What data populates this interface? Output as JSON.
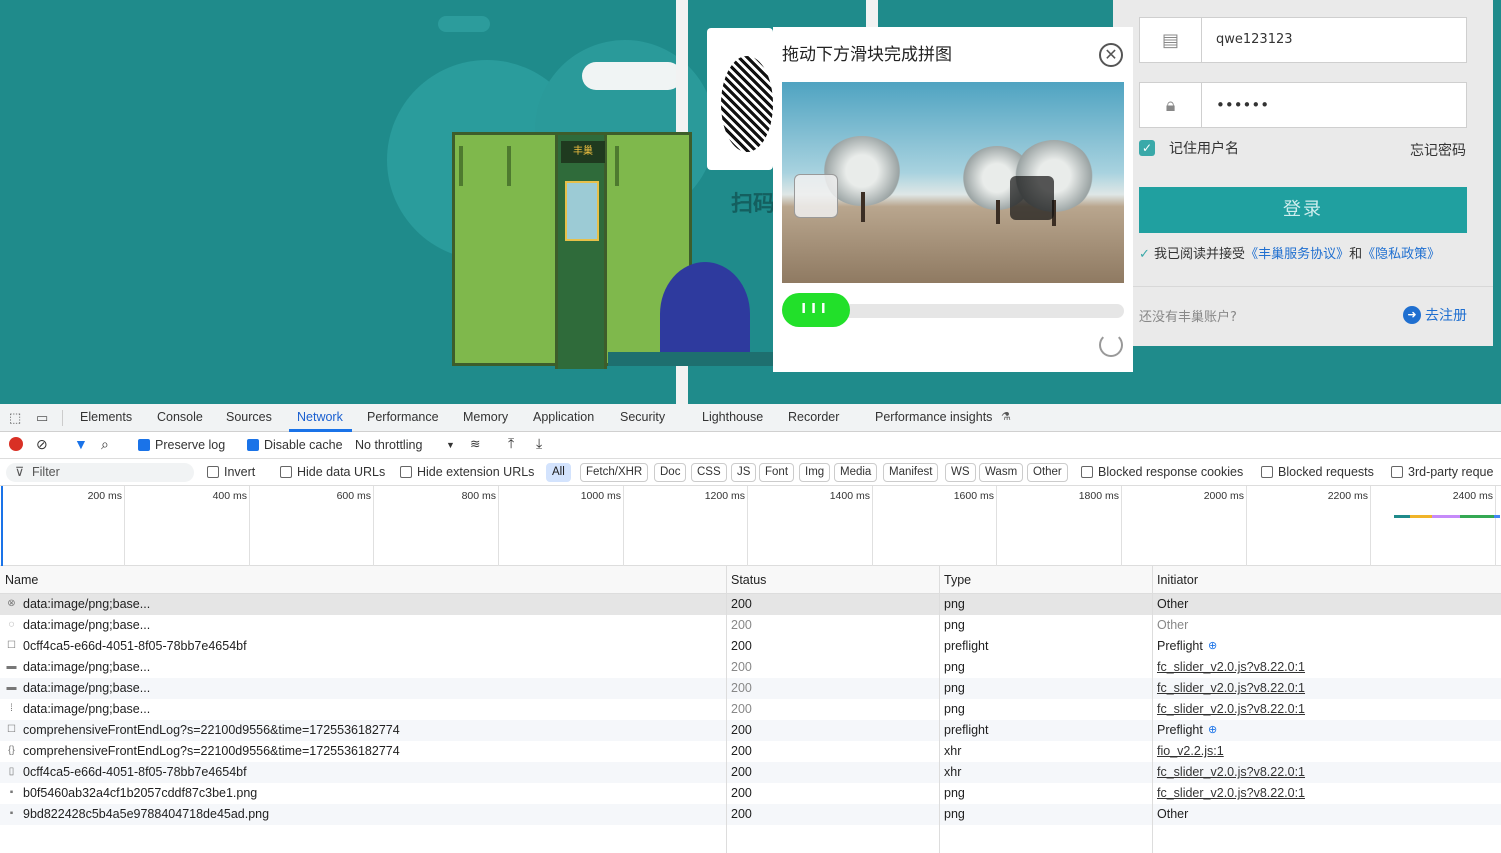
{
  "captcha": {
    "title": "拖动下方滑块完成拼图",
    "knob_label": "III",
    "slider_position_fraction": 0.0
  },
  "background_page": {
    "locker_sign": "丰巢",
    "scan_text": "扫码"
  },
  "login": {
    "username": "qwe123123",
    "password_masked": "••••••",
    "remember_label": "记住用户名",
    "forgot_label": "忘记密码",
    "login_button": "登录",
    "agree_prefix": "我已阅读并接受",
    "agree_terms": "《丰巢服务协议》",
    "agree_and": "和",
    "agree_privacy": "《隐私政策》",
    "no_account": "还没有丰巢账户?",
    "register": "去注册",
    "accent_color": "#20a0a0"
  },
  "devtools": {
    "tabs": [
      "Elements",
      "Console",
      "Sources",
      "Network",
      "Performance",
      "Memory",
      "Application",
      "Security",
      "Lighthouse",
      "Recorder",
      "Performance insights"
    ],
    "active_tab": "Network",
    "toolbar": {
      "preserve_log": "Preserve log",
      "disable_cache": "Disable cache",
      "throttling": "No throttling"
    },
    "filter": {
      "placeholder": "Filter",
      "invert": "Invert",
      "hide_data_urls": "Hide data URLs",
      "hide_extension_urls": "Hide extension URLs",
      "types": [
        "All",
        "Fetch/XHR",
        "Doc",
        "CSS",
        "JS",
        "Font",
        "Img",
        "Media",
        "Manifest",
        "WS",
        "Wasm",
        "Other"
      ],
      "blocked_cookies": "Blocked response cookies",
      "blocked_requests": "Blocked requests",
      "third_party": "3rd-party reque"
    },
    "timeline_ticks": [
      "200 ms",
      "400 ms",
      "600 ms",
      "800 ms",
      "1000 ms",
      "1200 ms",
      "1400 ms",
      "1600 ms",
      "1800 ms",
      "2000 ms",
      "2200 ms",
      "2400 ms"
    ],
    "columns": [
      "Name",
      "Status",
      "Type",
      "Initiator"
    ],
    "rows": [
      {
        "icon": "⊗",
        "name": "data:image/png;base...",
        "status": "200",
        "type": "png",
        "initiator": "Other",
        "style": "sel",
        "dim": false,
        "link": false
      },
      {
        "icon": "◌",
        "name": "data:image/png;base...",
        "status": "200",
        "type": "png",
        "initiator": "Other",
        "style": "",
        "dim": true,
        "link": false
      },
      {
        "icon": "☐",
        "name": "0cff4ca5-e66d-4051-8f05-78bb7e4654bf",
        "status": "200",
        "type": "preflight",
        "initiator": "Preflight",
        "style": "",
        "dim": false,
        "link": false
      },
      {
        "icon": "▬",
        "name": "data:image/png;base...",
        "status": "200",
        "type": "png",
        "initiator": "fc_slider_v2.0.js?v8.22.0:1",
        "style": "",
        "dim": true,
        "link": true
      },
      {
        "icon": "▬",
        "name": "data:image/png;base...",
        "status": "200",
        "type": "png",
        "initiator": "fc_slider_v2.0.js?v8.22.0:1",
        "style": "alt",
        "dim": true,
        "link": true
      },
      {
        "icon": "⁞",
        "name": "data:image/png;base...",
        "status": "200",
        "type": "png",
        "initiator": "fc_slider_v2.0.js?v8.22.0:1",
        "style": "",
        "dim": true,
        "link": true
      },
      {
        "icon": "☐",
        "name": "comprehensiveFrontEndLog?s=22100d9556&time=1725536182774",
        "status": "200",
        "type": "preflight",
        "initiator": "Preflight",
        "style": "alt",
        "dim": false,
        "link": false
      },
      {
        "icon": "{}",
        "name": "comprehensiveFrontEndLog?s=22100d9556&time=1725536182774",
        "status": "200",
        "type": "xhr",
        "initiator": "fio_v2.2.js:1",
        "style": "",
        "dim": false,
        "link": true
      },
      {
        "icon": "▯",
        "name": "0cff4ca5-e66d-4051-8f05-78bb7e4654bf",
        "status": "200",
        "type": "xhr",
        "initiator": "fc_slider_v2.0.js?v8.22.0:1",
        "style": "alt",
        "dim": false,
        "link": true
      },
      {
        "icon": "▪",
        "name": "b0f5460ab32a4cf1b2057cddf87c3be1.png",
        "status": "200",
        "type": "png",
        "initiator": "fc_slider_v2.0.js?v8.22.0:1",
        "style": "",
        "dim": false,
        "link": true
      },
      {
        "icon": "▪",
        "name": "9bd822428c5b4a5e9788404718de45ad.png",
        "status": "200",
        "type": "png",
        "initiator": "Other",
        "style": "alt",
        "dim": false,
        "link": false
      }
    ]
  }
}
